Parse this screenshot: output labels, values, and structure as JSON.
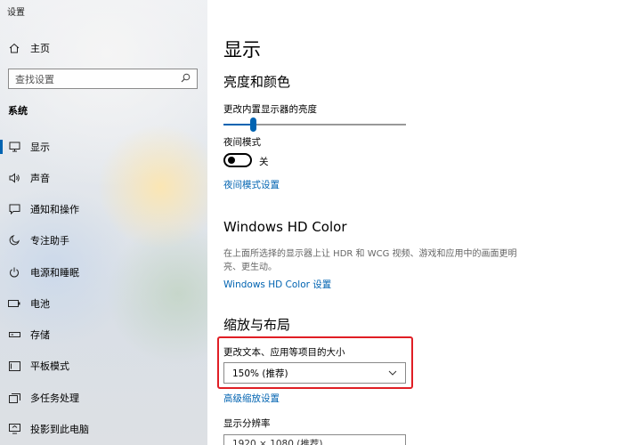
{
  "window": {
    "title": "设置"
  },
  "sidebar": {
    "home_label": "主页",
    "search_placeholder": "查找设置",
    "section": "系统",
    "items": [
      {
        "label": "显示",
        "icon": "monitor-icon",
        "active": true
      },
      {
        "label": "声音",
        "icon": "speaker-icon"
      },
      {
        "label": "通知和操作",
        "icon": "notification-icon"
      },
      {
        "label": "专注助手",
        "icon": "moon-icon"
      },
      {
        "label": "电源和睡眠",
        "icon": "power-icon"
      },
      {
        "label": "电池",
        "icon": "battery-icon"
      },
      {
        "label": "存储",
        "icon": "storage-icon"
      },
      {
        "label": "平板模式",
        "icon": "tablet-icon"
      },
      {
        "label": "多任务处理",
        "icon": "multitask-icon"
      },
      {
        "label": "投影到此电脑",
        "icon": "project-icon"
      }
    ]
  },
  "main": {
    "title": "显示",
    "brightness_section": {
      "heading": "亮度和颜色",
      "brightness_label": "更改内置显示器的亮度",
      "brightness_value": 0.16,
      "night_light_label": "夜间模式",
      "night_light_state": "关",
      "night_light_link": "夜间模式设置"
    },
    "hdr_section": {
      "heading": "Windows HD Color",
      "description": "在上面所选择的显示器上让 HDR 和 WCG 视频、游戏和应用中的画面更明亮、更生动。",
      "link": "Windows HD Color 设置"
    },
    "scale_section": {
      "heading": "缩放与布局",
      "scale_label": "更改文本、应用等项目的大小",
      "scale_value": "150% (推荐)",
      "advanced_link": "高级缩放设置",
      "resolution_label": "显示分辨率",
      "resolution_value": "1920 × 1080 (推荐)"
    }
  },
  "colors": {
    "accent": "#0063b1",
    "highlight": "#e01e25"
  }
}
